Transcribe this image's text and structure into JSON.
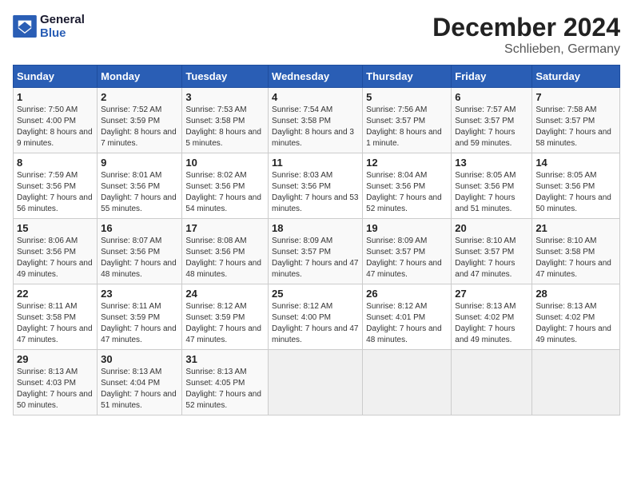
{
  "header": {
    "logo_line1": "General",
    "logo_line2": "Blue",
    "title": "December 2024",
    "subtitle": "Schlieben, Germany"
  },
  "calendar": {
    "days_of_week": [
      "Sunday",
      "Monday",
      "Tuesday",
      "Wednesday",
      "Thursday",
      "Friday",
      "Saturday"
    ],
    "weeks": [
      [
        {
          "day": "1",
          "sunrise": "7:50 AM",
          "sunset": "4:00 PM",
          "daylight": "8 hours and 9 minutes."
        },
        {
          "day": "2",
          "sunrise": "7:52 AM",
          "sunset": "3:59 PM",
          "daylight": "8 hours and 7 minutes."
        },
        {
          "day": "3",
          "sunrise": "7:53 AM",
          "sunset": "3:58 PM",
          "daylight": "8 hours and 5 minutes."
        },
        {
          "day": "4",
          "sunrise": "7:54 AM",
          "sunset": "3:58 PM",
          "daylight": "8 hours and 3 minutes."
        },
        {
          "day": "5",
          "sunrise": "7:56 AM",
          "sunset": "3:57 PM",
          "daylight": "8 hours and 1 minute."
        },
        {
          "day": "6",
          "sunrise": "7:57 AM",
          "sunset": "3:57 PM",
          "daylight": "7 hours and 59 minutes."
        },
        {
          "day": "7",
          "sunrise": "7:58 AM",
          "sunset": "3:57 PM",
          "daylight": "7 hours and 58 minutes."
        }
      ],
      [
        {
          "day": "8",
          "sunrise": "7:59 AM",
          "sunset": "3:56 PM",
          "daylight": "7 hours and 56 minutes."
        },
        {
          "day": "9",
          "sunrise": "8:01 AM",
          "sunset": "3:56 PM",
          "daylight": "7 hours and 55 minutes."
        },
        {
          "day": "10",
          "sunrise": "8:02 AM",
          "sunset": "3:56 PM",
          "daylight": "7 hours and 54 minutes."
        },
        {
          "day": "11",
          "sunrise": "8:03 AM",
          "sunset": "3:56 PM",
          "daylight": "7 hours and 53 minutes."
        },
        {
          "day": "12",
          "sunrise": "8:04 AM",
          "sunset": "3:56 PM",
          "daylight": "7 hours and 52 minutes."
        },
        {
          "day": "13",
          "sunrise": "8:05 AM",
          "sunset": "3:56 PM",
          "daylight": "7 hours and 51 minutes."
        },
        {
          "day": "14",
          "sunrise": "8:05 AM",
          "sunset": "3:56 PM",
          "daylight": "7 hours and 50 minutes."
        }
      ],
      [
        {
          "day": "15",
          "sunrise": "8:06 AM",
          "sunset": "3:56 PM",
          "daylight": "7 hours and 49 minutes."
        },
        {
          "day": "16",
          "sunrise": "8:07 AM",
          "sunset": "3:56 PM",
          "daylight": "7 hours and 48 minutes."
        },
        {
          "day": "17",
          "sunrise": "8:08 AM",
          "sunset": "3:56 PM",
          "daylight": "7 hours and 48 minutes."
        },
        {
          "day": "18",
          "sunrise": "8:09 AM",
          "sunset": "3:57 PM",
          "daylight": "7 hours and 47 minutes."
        },
        {
          "day": "19",
          "sunrise": "8:09 AM",
          "sunset": "3:57 PM",
          "daylight": "7 hours and 47 minutes."
        },
        {
          "day": "20",
          "sunrise": "8:10 AM",
          "sunset": "3:57 PM",
          "daylight": "7 hours and 47 minutes."
        },
        {
          "day": "21",
          "sunrise": "8:10 AM",
          "sunset": "3:58 PM",
          "daylight": "7 hours and 47 minutes."
        }
      ],
      [
        {
          "day": "22",
          "sunrise": "8:11 AM",
          "sunset": "3:58 PM",
          "daylight": "7 hours and 47 minutes."
        },
        {
          "day": "23",
          "sunrise": "8:11 AM",
          "sunset": "3:59 PM",
          "daylight": "7 hours and 47 minutes."
        },
        {
          "day": "24",
          "sunrise": "8:12 AM",
          "sunset": "3:59 PM",
          "daylight": "7 hours and 47 minutes."
        },
        {
          "day": "25",
          "sunrise": "8:12 AM",
          "sunset": "4:00 PM",
          "daylight": "7 hours and 47 minutes."
        },
        {
          "day": "26",
          "sunrise": "8:12 AM",
          "sunset": "4:01 PM",
          "daylight": "7 hours and 48 minutes."
        },
        {
          "day": "27",
          "sunrise": "8:13 AM",
          "sunset": "4:02 PM",
          "daylight": "7 hours and 49 minutes."
        },
        {
          "day": "28",
          "sunrise": "8:13 AM",
          "sunset": "4:02 PM",
          "daylight": "7 hours and 49 minutes."
        }
      ],
      [
        {
          "day": "29",
          "sunrise": "8:13 AM",
          "sunset": "4:03 PM",
          "daylight": "7 hours and 50 minutes."
        },
        {
          "day": "30",
          "sunrise": "8:13 AM",
          "sunset": "4:04 PM",
          "daylight": "7 hours and 51 minutes."
        },
        {
          "day": "31",
          "sunrise": "8:13 AM",
          "sunset": "4:05 PM",
          "daylight": "7 hours and 52 minutes."
        },
        null,
        null,
        null,
        null
      ]
    ]
  }
}
